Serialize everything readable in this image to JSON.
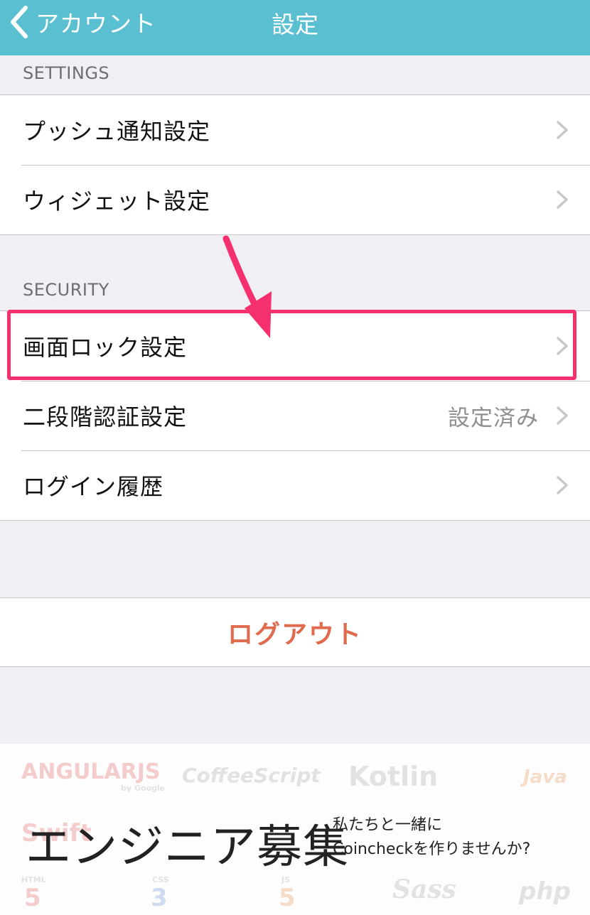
{
  "navbar": {
    "back_label": "アカウント",
    "title": "設定",
    "background": "#5bbfd2"
  },
  "sections": {
    "settings_header": "SETTINGS",
    "security_header": "SECURITY"
  },
  "settings_items": [
    {
      "label": "プッシュ通知設定"
    },
    {
      "label": "ウィジェット設定"
    }
  ],
  "security_items": [
    {
      "label": "画面ロック設定",
      "detail": ""
    },
    {
      "label": "二段階認証設定",
      "detail": "設定済み"
    },
    {
      "label": "ログイン履歴",
      "detail": ""
    }
  ],
  "logout": {
    "label": "ログアウト",
    "color": "#e06a4d"
  },
  "annotation": {
    "color": "#f5306f"
  },
  "banner": {
    "title": "エンジニア募集",
    "subtitle_line1": "私たちと一緒に",
    "subtitle_line2": "Coincheckを作りませんか?",
    "logos": [
      "ANGULARJS",
      "by Google",
      "CoffeeScript",
      "Kotlin",
      "Java",
      "Swift",
      "HTML",
      "5",
      "CSS",
      "3",
      "JS",
      "5",
      "Sass",
      "php"
    ]
  }
}
